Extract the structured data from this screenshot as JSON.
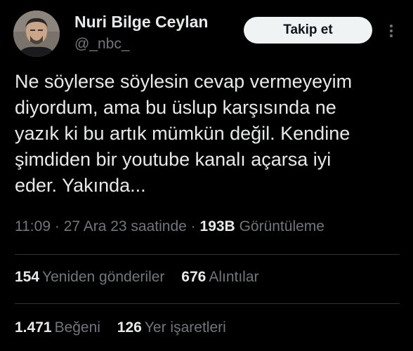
{
  "author": {
    "name": "Nuri Bilge Ceylan",
    "handle": "@_nbc_"
  },
  "follow_button": {
    "label": "Takip et"
  },
  "tweet": {
    "lines": [
      "Ne söylerse söylesin cevap vermeyeyim",
      "diyordum, ama bu üslup karşısında ne",
      "yazık ki bu artık mümkün değil. Kendine",
      "şimdiden bir youtube kanalı açarsa iyi",
      "eder. Yakında..."
    ]
  },
  "meta": {
    "time": "11:09",
    "sep1": "·",
    "date": "27 Ara 23 saatinde",
    "sep2": "·",
    "views": "193B",
    "views_label": "Görüntüleme"
  },
  "stats": {
    "reposts": {
      "count": "154",
      "label": "Yeniden gönderiler"
    },
    "quotes": {
      "count": "676",
      "label": "Alıntılar"
    },
    "likes": {
      "count": "1.471",
      "label": "Beğeni"
    },
    "bookmarks": {
      "count": "126",
      "label": "Yer işaretleri"
    }
  },
  "colors": {
    "background": "#000000",
    "text_primary": "#e7e9ea",
    "text_secondary": "#71767b",
    "button_bg": "#eff3f4",
    "divider": "#2f3336"
  },
  "icons": {
    "more": "more-vertical-icon"
  }
}
